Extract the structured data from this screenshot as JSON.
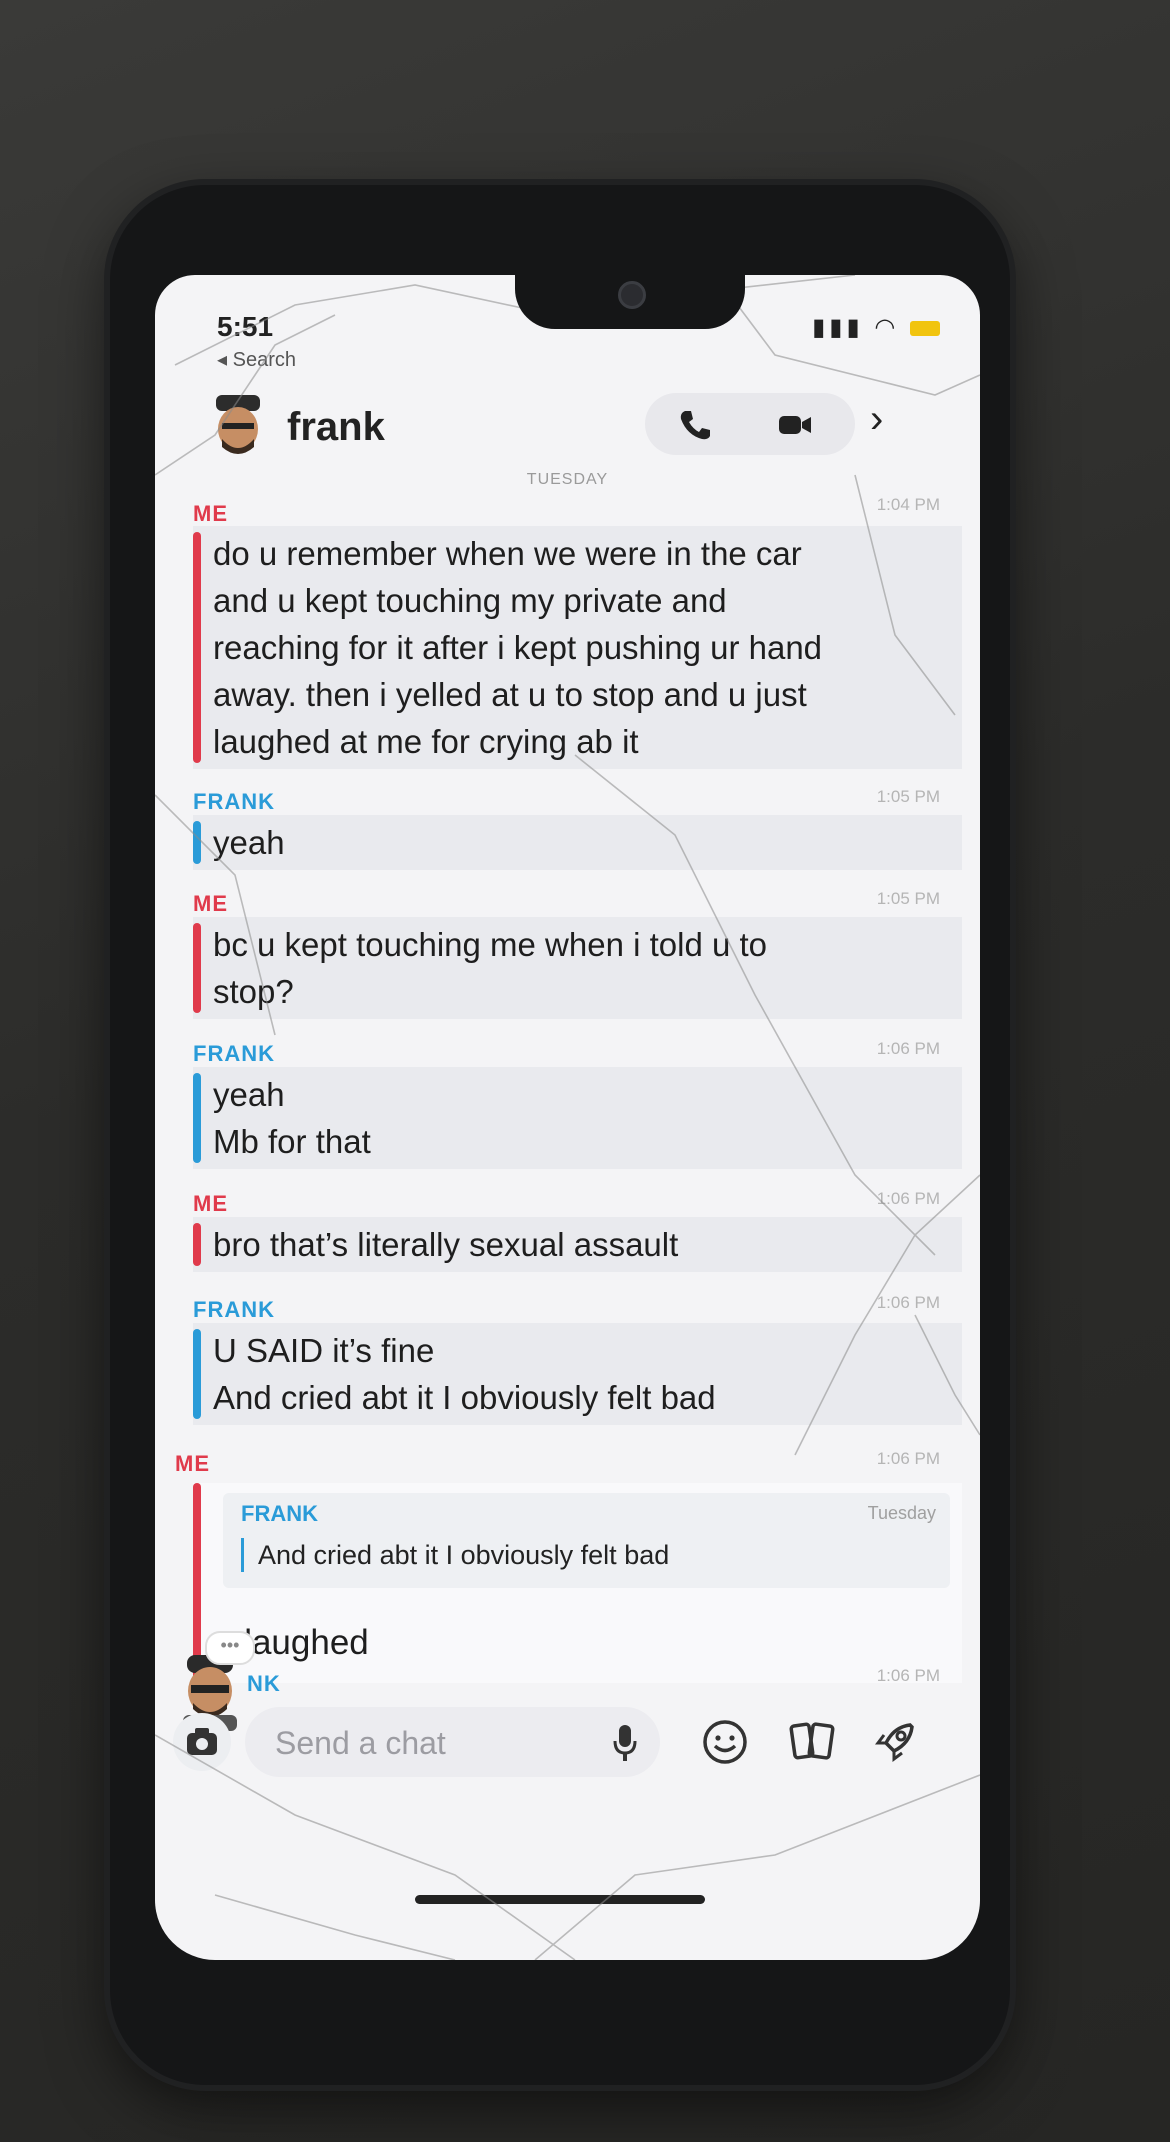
{
  "status_bar": {
    "time": "5:51",
    "signal": "▮▮▮",
    "wifi": "wifi",
    "back_label": "Search"
  },
  "header": {
    "contact_name": "frank",
    "icons": [
      "phone-icon",
      "video-icon",
      "chevron-right-icon"
    ]
  },
  "day_label": "TUESDAY",
  "messages": [
    {
      "sender": "ME",
      "time": "1:04 PM",
      "lines": [
        "do u remember when we were in the car",
        "and u kept touching my private and",
        "reaching for it after i kept pushing ur hand",
        "away. then i yelled at u to stop and u just",
        "laughed at me for crying ab it"
      ]
    },
    {
      "sender": "FRANK",
      "time": "1:05 PM",
      "lines": [
        "yeah"
      ]
    },
    {
      "sender": "ME",
      "time": "1:05 PM",
      "lines": [
        "bc u kept touching me when i told u to",
        "stop?"
      ]
    },
    {
      "sender": "FRANK",
      "time": "1:06 PM",
      "lines": [
        "yeah",
        "Mb for that"
      ]
    },
    {
      "sender": "ME",
      "time": "1:06 PM",
      "lines": [
        "bro that’s literally sexual assault"
      ]
    },
    {
      "sender": "FRANK",
      "time": "1:06 PM",
      "lines": [
        "U SAID it’s fine",
        "And cried abt it I obviously felt bad"
      ]
    },
    {
      "sender": "ME",
      "time": "1:06 PM",
      "quote": {
        "sender": "FRANK",
        "day": "Tuesday",
        "text": "And cried abt it I obviously felt bad"
      },
      "reply": "u laughed"
    }
  ],
  "partial": {
    "sender": "NK",
    "time": "1:06 PM",
    "typing": "•••"
  },
  "input": {
    "placeholder": "Send a chat"
  },
  "colors": {
    "me": "#e03a4b",
    "friend": "#2a9bd8",
    "bubble": "#e9eaee"
  }
}
